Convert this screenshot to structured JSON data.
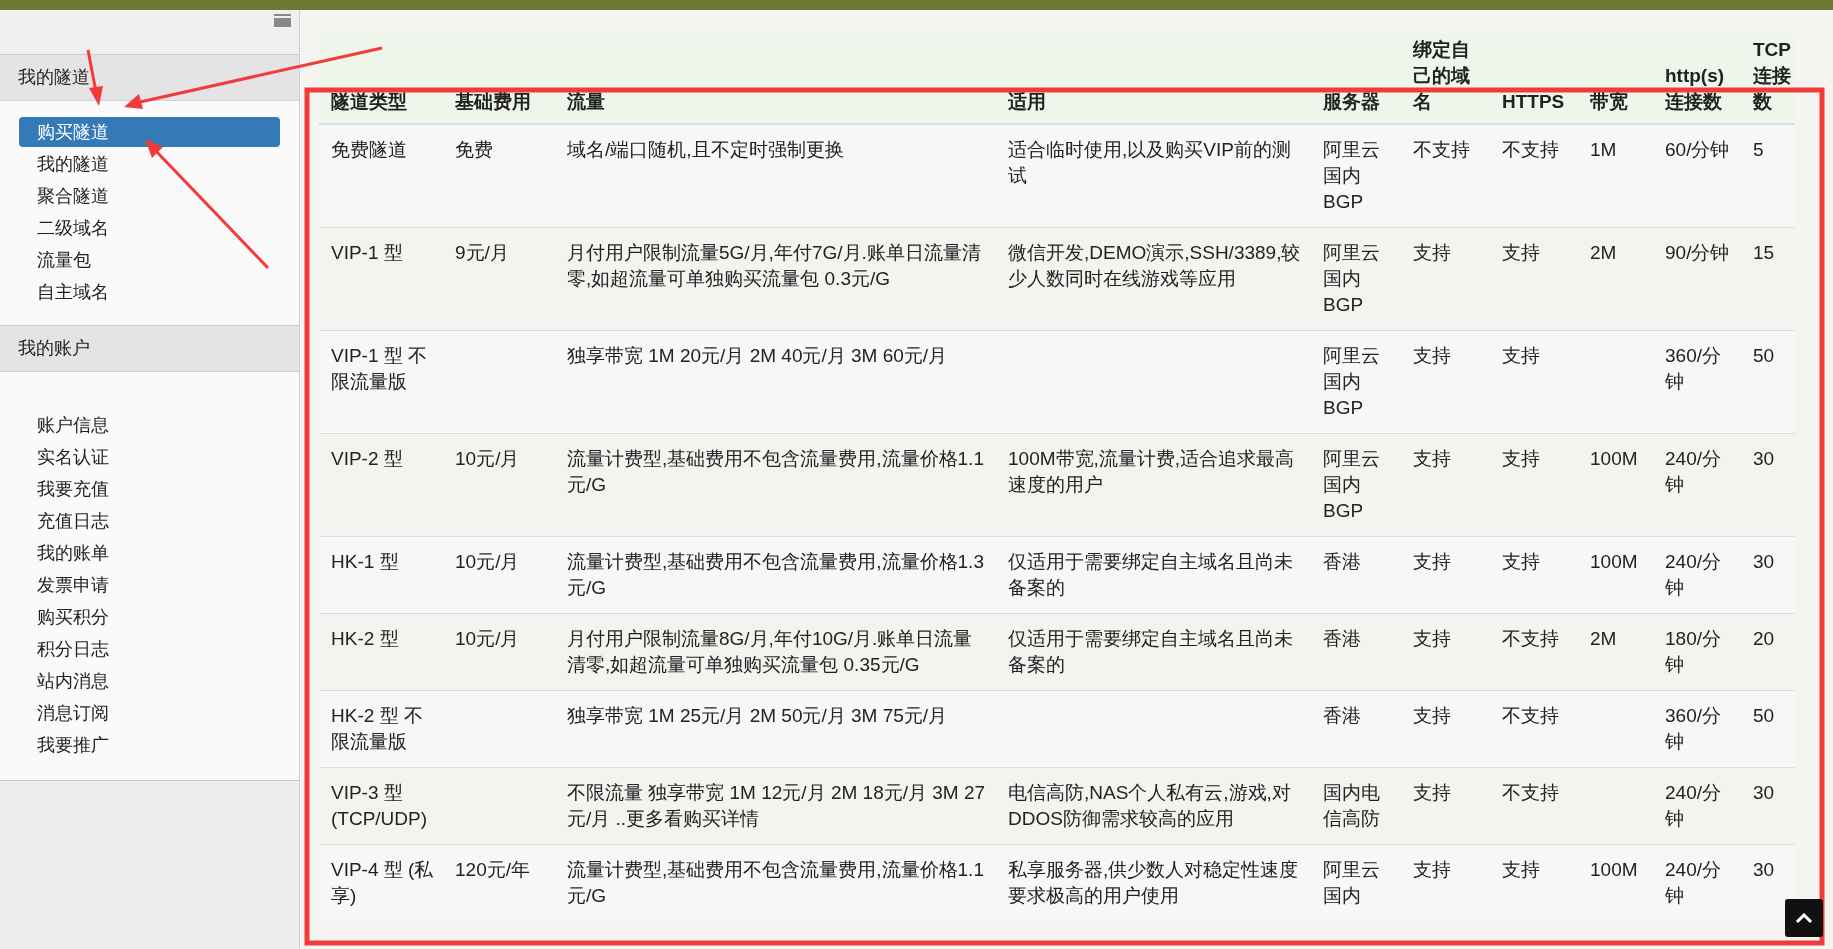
{
  "sidebar": {
    "sections": [
      {
        "title": "我的隧道",
        "items": [
          {
            "label": "购买隧道",
            "selected": true
          },
          {
            "label": "我的隧道",
            "selected": false
          },
          {
            "label": "聚合隧道",
            "selected": false
          },
          {
            "label": "二级域名",
            "selected": false
          },
          {
            "label": "流量包",
            "selected": false
          },
          {
            "label": "自主域名",
            "selected": false
          }
        ]
      },
      {
        "title": "我的账户",
        "items": [
          {
            "label": "账户信息",
            "selected": false
          },
          {
            "label": "实名认证",
            "selected": false
          },
          {
            "label": "我要充值",
            "selected": false
          },
          {
            "label": "充值日志",
            "selected": false
          },
          {
            "label": "我的账单",
            "selected": false
          },
          {
            "label": "发票申请",
            "selected": false
          },
          {
            "label": "购买积分",
            "selected": false
          },
          {
            "label": "积分日志",
            "selected": false
          },
          {
            "label": "站内消息",
            "selected": false
          },
          {
            "label": "消息订阅",
            "selected": false
          },
          {
            "label": "我要推广",
            "selected": false
          }
        ]
      }
    ]
  },
  "table": {
    "columns": [
      "隧道类型",
      "基础费用",
      "流量",
      "适用",
      "服务器",
      "绑定自己的域名",
      "HTTPS",
      "带宽",
      "http(s)连接数",
      "TCP连接数"
    ],
    "rows": [
      [
        "免费隧道",
        "免费",
        "域名/端口随机,且不定时强制更换",
        "适合临时使用,以及购买VIP前的测试",
        "阿里云国内BGP",
        "不支持",
        "不支持",
        "1M",
        "60/分钟",
        "5"
      ],
      [
        "VIP-1 型",
        "9元/月",
        "月付用户限制流量5G/月,年付7G/月.账单日流量清零,如超流量可单独购买流量包 0.3元/G",
        "微信开发,DEMO演示,SSH/3389,较少人数同时在线游戏等应用",
        "阿里云国内BGP",
        "支持",
        "支持",
        "2M",
        "90/分钟",
        "15"
      ],
      [
        "VIP-1 型 不限流量版",
        "",
        "独享带宽 1M 20元/月 2M 40元/月 3M 60元/月",
        "",
        "阿里云国内BGP",
        "支持",
        "支持",
        "",
        "360/分钟",
        "50"
      ],
      [
        "VIP-2 型",
        "10元/月",
        "流量计费型,基础费用不包含流量费用,流量价格1.1元/G",
        "100M带宽,流量计费,适合追求最高速度的用户",
        "阿里云国内BGP",
        "支持",
        "支持",
        "100M",
        "240/分钟",
        "30"
      ],
      [
        "HK-1 型",
        "10元/月",
        "流量计费型,基础费用不包含流量费用,流量价格1.3元/G",
        "仅适用于需要绑定自主域名且尚未备案的",
        "香港",
        "支持",
        "支持",
        "100M",
        "240/分钟",
        "30"
      ],
      [
        "HK-2 型",
        "10元/月",
        "月付用户限制流量8G/月,年付10G/月.账单日流量清零,如超流量可单独购买流量包 0.35元/G",
        "仅适用于需要绑定自主域名且尚未备案的",
        "香港",
        "支持",
        "不支持",
        "2M",
        "180/分钟",
        "20"
      ],
      [
        "HK-2 型 不限流量版",
        "",
        "独享带宽 1M 25元/月 2M 50元/月 3M 75元/月",
        "",
        "香港",
        "支持",
        "不支持",
        "",
        "360/分钟",
        "50"
      ],
      [
        "VIP-3 型 (TCP/UDP)",
        "",
        "不限流量 独享带宽 1M 12元/月 2M 18元/月 3M 27元/月 ..更多看购买详情",
        "电信高防,NAS个人私有云,游戏,对DDOS防御需求较高的应用",
        "国内电信高防",
        "支持",
        "不支持",
        "",
        "240/分钟",
        "30"
      ],
      [
        "VIP-4 型 (私享)",
        "120元/年",
        "流量计费型,基础费用不包含流量费用,流量价格1.1元/G",
        "私享服务器,供少数人对稳定性速度要求极高的用户使用",
        "阿里云国内",
        "支持",
        "支持",
        "100M",
        "240/分钟",
        "30"
      ]
    ]
  }
}
